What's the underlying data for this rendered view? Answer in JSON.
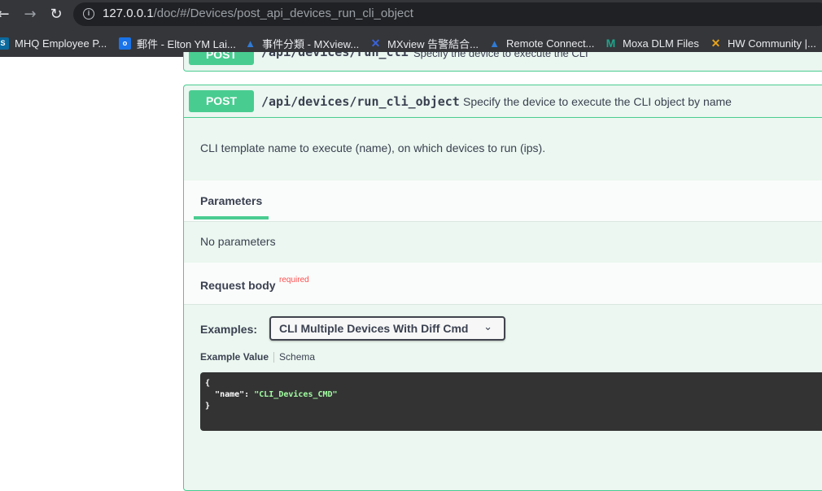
{
  "browser": {
    "url_host": "127.0.0.1",
    "url_path": "/doc/#/Devices/post_api_devices_run_cli_object",
    "bookmarks": [
      {
        "label": "MHQ Employee P...",
        "icon": "sharepoint-icon",
        "color": "#0b6a9e"
      },
      {
        "label": "郵件 - Elton YM Lai...",
        "icon": "outlook-icon",
        "color": "#1a73e8"
      },
      {
        "label": "事件分類 - MXview...",
        "icon": "azure-devops-icon",
        "color": "#2f7bd6"
      },
      {
        "label": "MXview 告警結合...",
        "icon": "mxview-icon",
        "color": "#3b63d9"
      },
      {
        "label": "Remote Connect...",
        "icon": "azure-devops-icon",
        "color": "#2f7bd6"
      },
      {
        "label": "Moxa DLM Files",
        "icon": "moxa-icon",
        "color": "#1fa38a"
      },
      {
        "label": "HW Community |...",
        "icon": "hw-icon",
        "color": "#e5a21a"
      }
    ]
  },
  "prev_op": {
    "method": "POST",
    "path": "/api/devices/run_cli",
    "summary": "Specify the device to execute the CLI"
  },
  "op": {
    "method": "POST",
    "path": "/api/devices/run_cli_object",
    "summary": "Specify the device to execute the CLI object by name",
    "description": "CLI template name to execute (name), on which devices to run (ips).",
    "parameters_tab": "Parameters",
    "no_parameters": "No parameters",
    "request_body_title": "Request body",
    "required_label": "required",
    "examples_label": "Examples:",
    "example_selected": "CLI Multiple Devices With Diff Cmd",
    "tab_example_value": "Example Value",
    "tab_schema": "Schema",
    "code": {
      "open": "{",
      "key": "\"name\"",
      "colon": ": ",
      "value": "\"CLI_Devices_CMD\"",
      "close": "}"
    }
  },
  "colors": {
    "post_green": "#49cc90",
    "op_bg": "#ebf7f0",
    "required_red": "#ff4f4f",
    "code_bg": "#333333"
  }
}
